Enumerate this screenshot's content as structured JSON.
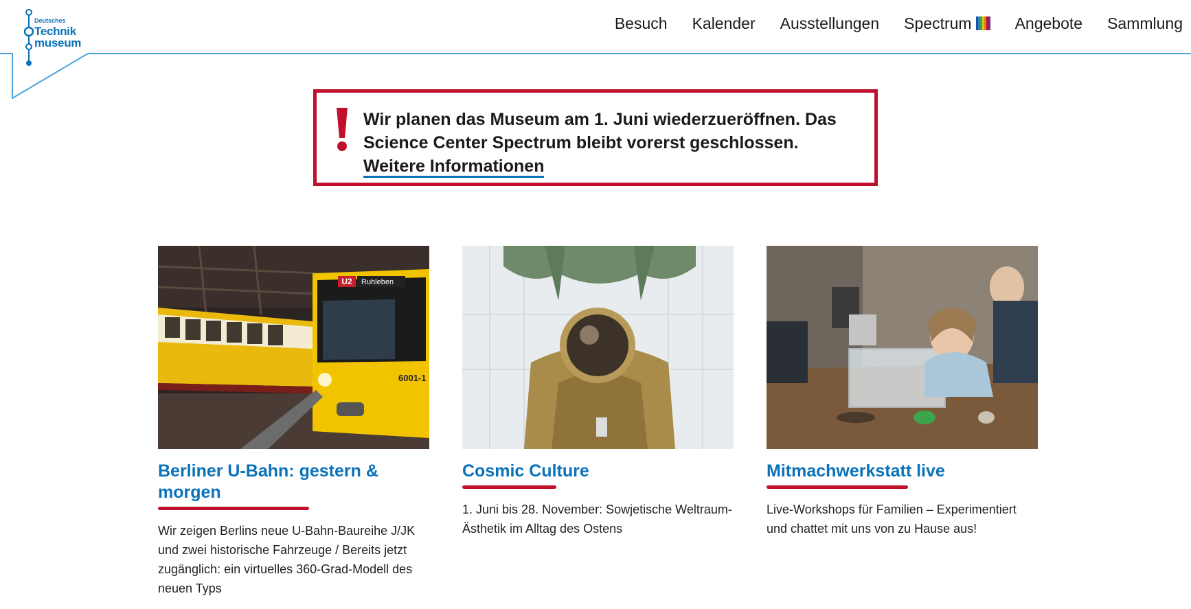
{
  "logo": {
    "line1": "Deutsches",
    "line2": "Technik",
    "line3": "museum"
  },
  "nav": {
    "items": [
      "Besuch",
      "Kalender",
      "Ausstellungen",
      "Spectrum",
      "Angebote",
      "Sammlung"
    ],
    "spectrum_icon": "color-bars-icon"
  },
  "alert": {
    "text": "Wir planen das Museum am 1. Juni wiederzueröffnen. Das Science Center Spectrum bleibt vorerst geschlossen.",
    "link": "Weitere Informationen",
    "icon": "exclamation-icon"
  },
  "cards": [
    {
      "title": "Berliner U-Bahn: gestern & morgen",
      "text": "Wir zeigen Berlins neue U-Bahn-Baureihe J/JK und zwei historische Fahrzeuge / Bereits jetzt zugänglich: ein virtuelles 360-Grad-Modell des neuen Typs",
      "image": {
        "sign_line": "U2",
        "sign_dest": "Ruhleben",
        "number": "6001-1"
      }
    },
    {
      "title": "Cosmic Culture",
      "text": "1. Juni bis 28. November: Sowjetische Weltraum-Ästhetik im Alltag des Ostens"
    },
    {
      "title": "Mitmachwerkstatt live",
      "text": "Live-Workshops für Familien – Experimentiert und chattet mit uns von zu Hause aus!"
    }
  ],
  "colors": {
    "accent_blue": "#0a72b9",
    "accent_red": "#c0102b"
  }
}
